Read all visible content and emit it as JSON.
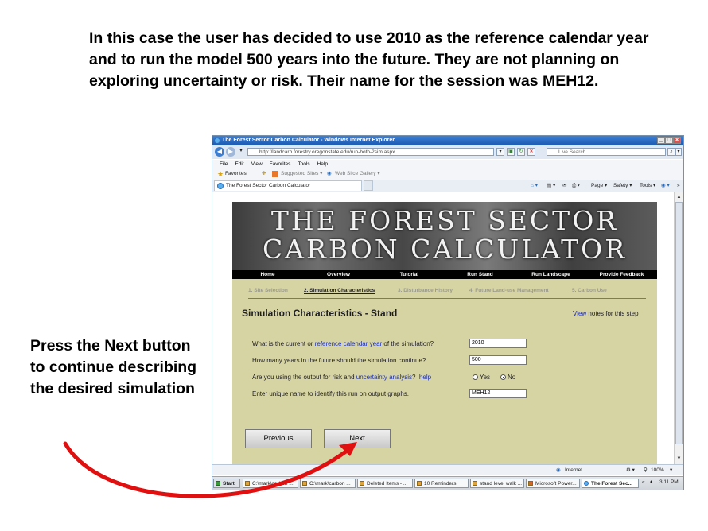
{
  "slide": {
    "title": "In this case the user has decided to use 2010 as the reference calendar year and to run the model 500 years into the future. They are not planning on exploring uncertainty or risk. Their name for the session was MEH12.",
    "side_note": "Press the Next button to continue describing the desired simulation"
  },
  "browser": {
    "window_title": "The Forest Sector Carbon Calculator - Windows Internet Explorer",
    "address": "http://landcarb.forestry.oregonstate.edu/run-both-2sim.aspx",
    "search_placeholder": "Live Search",
    "menu": [
      "File",
      "Edit",
      "View",
      "Favorites",
      "Tools",
      "Help"
    ],
    "favorites_label": "Favorites",
    "suggested_sites": "Suggested Sites ▾",
    "web_slice_gallery": "Web Slice Gallery ▾",
    "tab_title": "The Forest Sector Carbon Calculator",
    "command_bar": {
      "page": "Page ▾",
      "safety": "Safety ▾",
      "tools": "Tools ▾"
    }
  },
  "page": {
    "banner_line1": "THE FOREST SECTOR",
    "banner_line2": "CARBON CALCULATOR",
    "nav": [
      "Home",
      "Overview",
      "Tutorial",
      "Run Stand",
      "Run Landscape",
      "Provide Feedback"
    ],
    "steps": [
      "1. Site Selection",
      "2. Simulation Characteristics",
      "3. Disturbance History",
      "4. Future Land-use Management",
      "5. Carbon Use"
    ],
    "section_title": "Simulation Characteristics - Stand",
    "view_notes": {
      "link": "View",
      "rest": " notes for this step"
    },
    "questions": {
      "q1_before": "What is the current or ",
      "q1_link": "reference calendar year",
      "q1_after": " of the simulation?",
      "q1_value": "2010",
      "q2": "How many years in the future should the simulation continue?",
      "q2_value": "500",
      "q3_before": "Are you using the output for risk and ",
      "q3_link": "uncertainty analysis",
      "q3_after": "?",
      "q3_help": "help",
      "q3_yes": "Yes",
      "q3_no": "No",
      "q4": "Enter unique name to identify this run on output graphs.",
      "q4_value": "MEH12"
    },
    "previous_label": "Previous",
    "next_label": "Next"
  },
  "status": {
    "zone": "Internet",
    "zoom": "100%"
  },
  "taskbar": {
    "start": "Start",
    "items": [
      "C:\\mark\\carbon ...",
      "C:\\mark\\carbon ...",
      "Deleted Items - ...",
      "10 Reminders",
      "stand level walk ...",
      "Microsoft Power...",
      "The Forest Sec..."
    ],
    "clock": "3:11 PM"
  },
  "colors": {
    "page_bg": "#d7d4a4",
    "link": "#1a2fb8",
    "arrow": "#e01010",
    "titlebar": "#1c58b0"
  }
}
